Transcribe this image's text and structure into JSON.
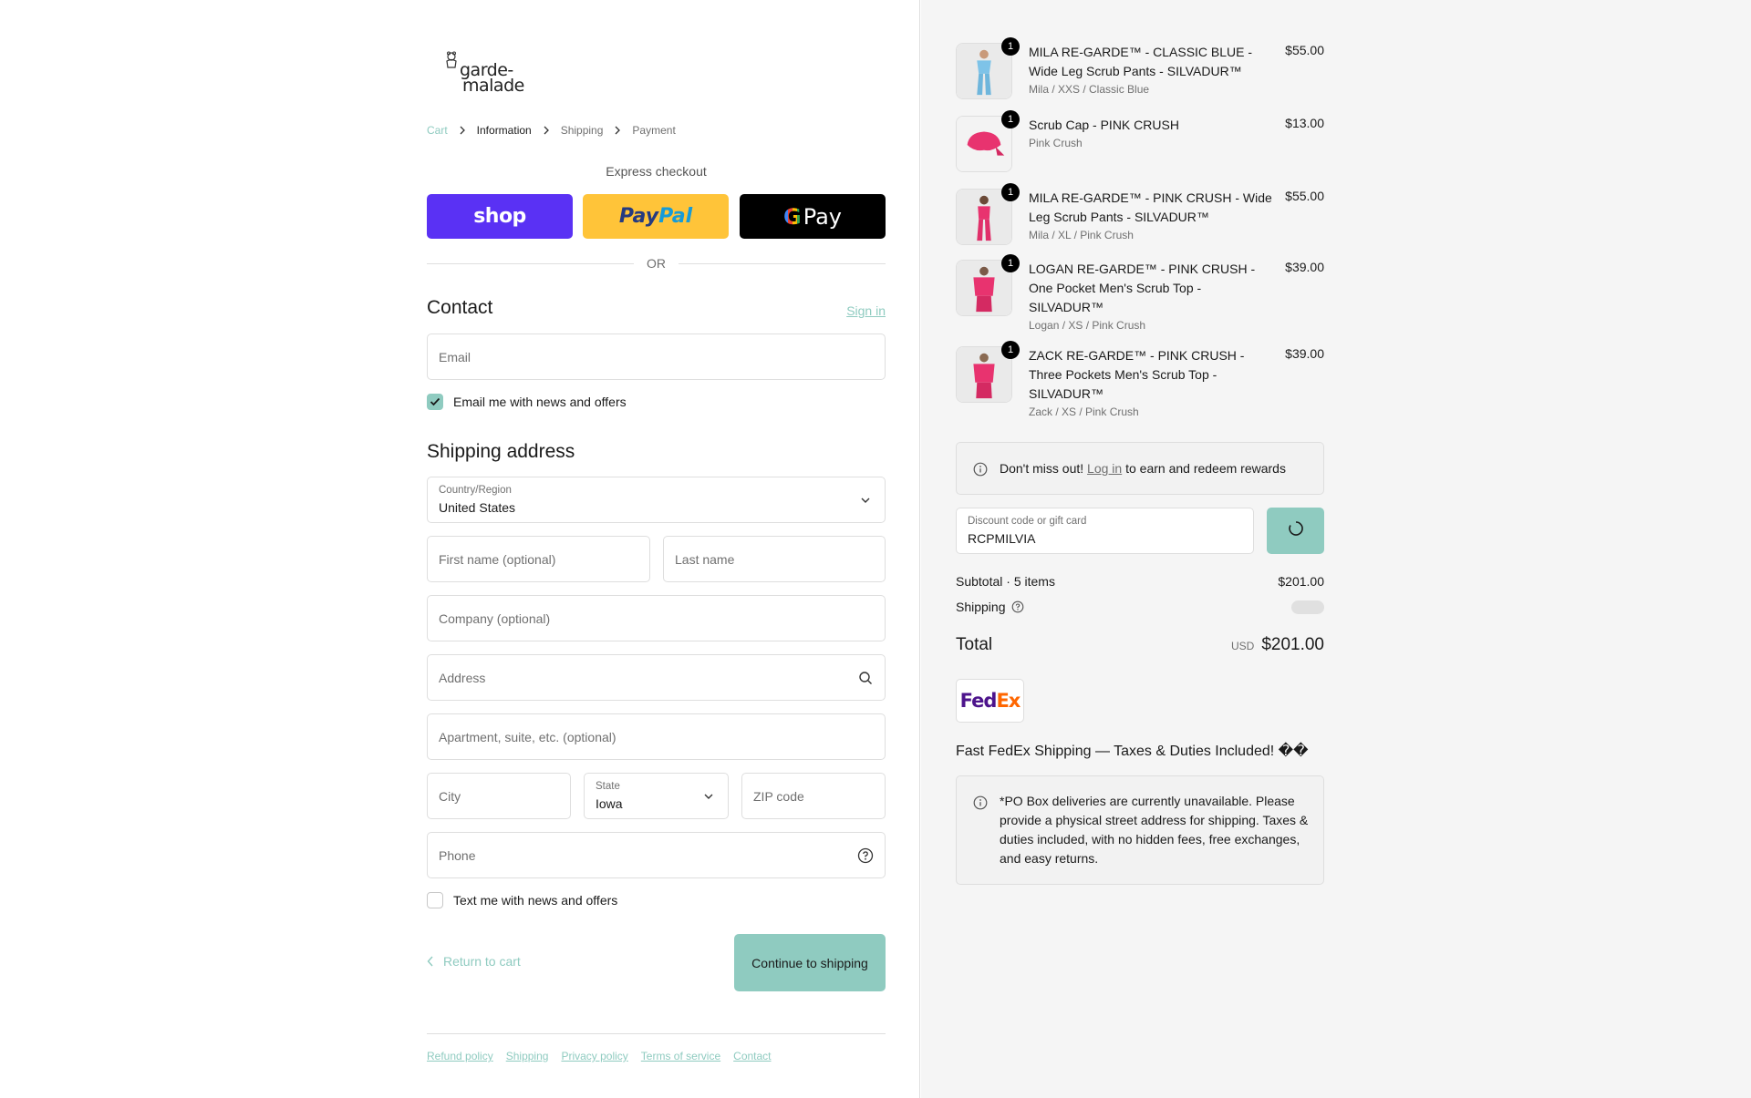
{
  "brand": {
    "line1": "garde-",
    "line2": "malade"
  },
  "breadcrumb": {
    "cart": "Cart",
    "information": "Information",
    "shipping": "Shipping",
    "payment": "Payment"
  },
  "express": {
    "label": "Express checkout",
    "shop": "shop",
    "paypal_a": "Pay",
    "paypal_b": "Pal",
    "gpay_g": "G",
    "gpay": "Pay",
    "or": "OR"
  },
  "contact": {
    "title": "Contact",
    "signin": "Sign in",
    "email_placeholder": "Email",
    "news_checkbox": "Email me with news and offers"
  },
  "shipping": {
    "title": "Shipping address",
    "country_label": "Country/Region",
    "country_value": "United States",
    "first_name": "First name (optional)",
    "last_name": "Last name",
    "company": "Company (optional)",
    "address": "Address",
    "apartment": "Apartment, suite, etc. (optional)",
    "city": "City",
    "state_label": "State",
    "state_value": "Iowa",
    "zip": "ZIP code",
    "phone": "Phone",
    "sms_checkbox": "Text me with news and offers"
  },
  "actions": {
    "return": "Return to cart",
    "continue": "Continue to shipping"
  },
  "footer": [
    "Refund policy",
    "Shipping",
    "Privacy policy",
    "Terms of service",
    "Contact"
  ],
  "cart": {
    "items": [
      {
        "qty": "1",
        "name": "MILA RE-GARDE™ - CLASSIC BLUE - Wide Leg Scrub Pants - SILVADUR™",
        "variant": "Mila / XXS / Classic Blue",
        "price": "$55.00",
        "color": "#6fb6dc"
      },
      {
        "qty": "1",
        "name": "Scrub Cap - PINK CRUSH",
        "variant": "Pink Crush",
        "price": "$13.00",
        "color": "#e8336f"
      },
      {
        "qty": "1",
        "name": "MILA RE-GARDE™ - PINK CRUSH - Wide Leg Scrub Pants - SILVADUR™",
        "variant": "Mila / XL / Pink Crush",
        "price": "$55.00",
        "color": "#e8336f"
      },
      {
        "qty": "1",
        "name": "LOGAN RE-GARDE™ - PINK CRUSH - One Pocket Men's Scrub Top - SILVADUR™",
        "variant": "Logan / XS / Pink Crush",
        "price": "$39.00",
        "color": "#e8336f"
      },
      {
        "qty": "1",
        "name": "ZACK RE-GARDE™ - PINK CRUSH - Three Pockets Men's Scrub Top - SILVADUR™",
        "variant": "Zack / XS / Pink Crush",
        "price": "$39.00",
        "color": "#e8336f"
      }
    ],
    "rewards_prefix": "Don't miss out! ",
    "rewards_link": "Log in",
    "rewards_suffix": " to earn and redeem rewards",
    "discount_label": "Discount code or gift card",
    "discount_value": "RCPMILVIA",
    "subtotal_label": "Subtotal · 5 items",
    "subtotal_value": "$201.00",
    "shipping_label": "Shipping",
    "total_label": "Total",
    "currency": "USD",
    "total_value": "$201.00",
    "fedex_fe": "Fed",
    "fedex_ex": "Ex",
    "shipping_note": "Fast FedEx Shipping — Taxes & Duties Included! ��",
    "po_note": "*PO Box deliveries are currently unavailable. Please provide a physical street address for shipping. Taxes & duties included, with no hidden fees, free exchanges, and easy returns."
  },
  "colors": {
    "accent": "#8fcbc0",
    "shop": "#5a31f4",
    "paypal": "#ffc439",
    "gpay": "#000000"
  }
}
